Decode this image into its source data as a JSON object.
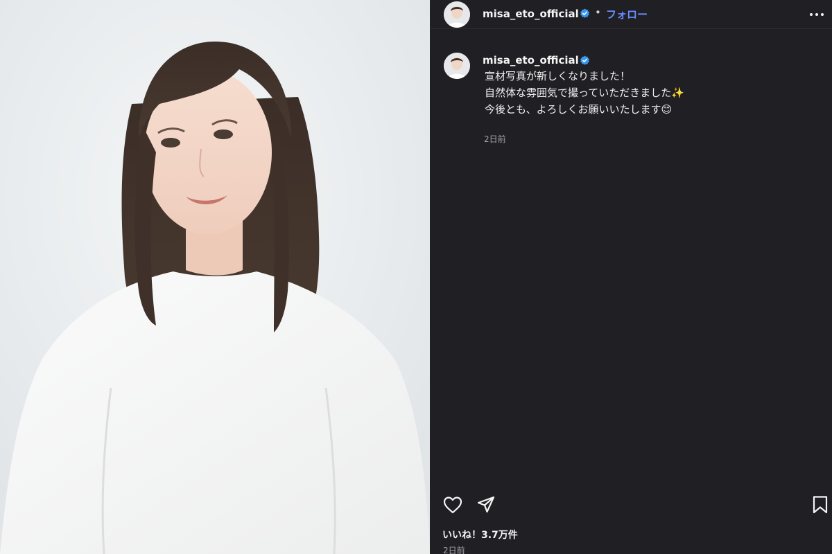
{
  "post": {
    "photo_alt": "woman in white blouse portrait",
    "username": "misa_eto_official",
    "follow_label": "フォロー",
    "separator": "•",
    "caption": {
      "lines": [
        "宣材写真が新しくなりました！",
        "自然体な雰囲気で撮っていただきました✨",
        "今後とも、よろしくお願いいたします😊"
      ]
    },
    "caption_time": "2日前",
    "likes_label": "いいね！3.7万件",
    "post_time": "2日前"
  },
  "icons": {
    "verified": "verified-badge-icon",
    "more": "more-options-icon",
    "like": "heart-icon",
    "share": "paper-plane-icon",
    "save": "bookmark-icon"
  },
  "colors": {
    "sidebar_bg": "#1f1f24",
    "accent_follow": "#6b8cff",
    "verified_blue": "#3897f0",
    "muted_text": "#a5a5a8"
  }
}
